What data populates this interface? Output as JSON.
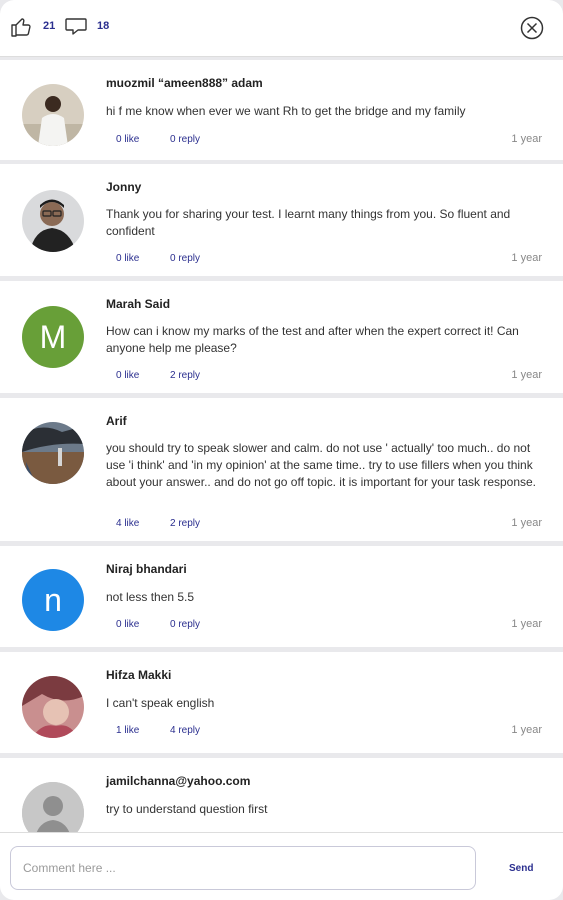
{
  "header": {
    "like_count": "21",
    "comment_count": "18",
    "accent_color": "#2b2f8f"
  },
  "comments": [
    {
      "author": "muozmil “ameen888” adam",
      "text": "hi f me know when ever we want Rh to get the bridge and my family",
      "likes": "0 like",
      "replies": "0 reply",
      "time": "1 year",
      "avatar": {
        "type": "photo",
        "icon": "person-white-robe-photo"
      }
    },
    {
      "author": "Jonny",
      "text": "Thank you for sharing your test. I learnt many things from you. So fluent and confident",
      "likes": "0 like",
      "replies": "0 reply",
      "time": "1 year",
      "avatar": {
        "type": "photo",
        "icon": "man-with-glasses-photo"
      }
    },
    {
      "author": "Marah Said",
      "text": "How can i know my marks  of the test and after when the expert correct it! Can anyone help me please?",
      "likes": "0 like",
      "replies": "2 reply",
      "time": "1 year",
      "avatar": {
        "type": "letter",
        "letter": "M",
        "color": "#689f38"
      }
    },
    {
      "author": "Arif",
      "text": "you should try to speak slower and calm. do not use ' actually' too much.. do not use 'i think' and 'in my opinion' at the same time.. try to use fillers when you think about your answer.. and do not go off topic. it is important for your task response.",
      "likes": "4 like",
      "replies": "2 reply",
      "time": "1 year",
      "avatar": {
        "type": "photo",
        "icon": "landscape-photo"
      }
    },
    {
      "author": "Niraj bhandari",
      "text": "not less then 5.5",
      "likes": "0 like",
      "replies": "0 reply",
      "time": "1 year",
      "avatar": {
        "type": "letter",
        "letter": "n",
        "color": "#1e88e5"
      }
    },
    {
      "author": "Hifza Makki",
      "text": "I can't speak english",
      "likes": "1 like",
      "replies": "4 reply",
      "time": "1 year",
      "avatar": {
        "type": "photo",
        "icon": "portrait-photo"
      }
    },
    {
      "author": "jamilchanna@yahoo.com",
      "text": "try to understand question first",
      "likes": "",
      "replies": "",
      "time": "",
      "avatar": {
        "type": "placeholder",
        "icon": "default-user-icon"
      }
    }
  ],
  "footer": {
    "placeholder": "Comment here ...",
    "value": "",
    "send_label": "Send"
  }
}
